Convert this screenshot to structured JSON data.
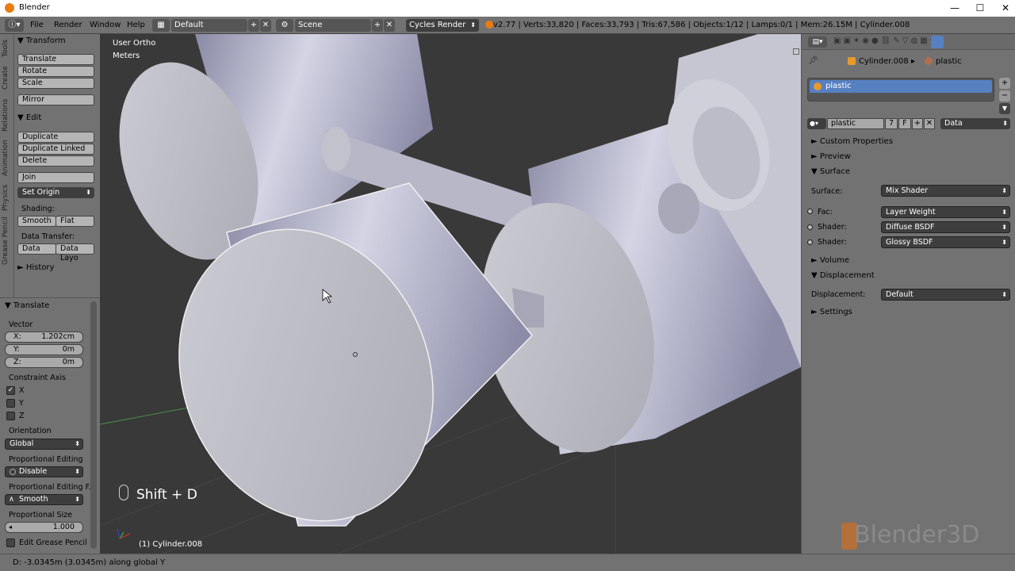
{
  "window": {
    "title": "Blender",
    "controls": [
      "—",
      "☐",
      "✕"
    ]
  },
  "header": {
    "menus": [
      "File",
      "Render",
      "Window",
      "Help"
    ],
    "layout": "Default",
    "scene": "Scene",
    "engine": "Cycles Render",
    "stats": "v2.77 | Verts:33,820 | Faces:33,793 | Tris:67,586 | Objects:1/12 | Lamps:0/1 | Mem:26.15M | Cylinder.008"
  },
  "tool_tabs": [
    "Tools",
    "Create",
    "Relations",
    "Animation",
    "Physics",
    "Grease Pencil"
  ],
  "toolshelf": {
    "transform_header": "Transform",
    "transform_buttons": [
      "Translate",
      "Rotate",
      "Scale"
    ],
    "mirror": "Mirror",
    "edit_header": "Edit",
    "edit_buttons": [
      "Duplicate",
      "Duplicate Linked",
      "Delete"
    ],
    "join": "Join",
    "set_origin": "Set Origin",
    "shading_label": "Shading:",
    "smooth": "Smooth",
    "flat": "Flat",
    "data_transfer_label": "Data Transfer:",
    "data": "Data",
    "data_layout": "Data Layo",
    "history_header": "History"
  },
  "operator": {
    "header": "Translate",
    "vector_label": "Vector",
    "x_label": "X:",
    "x_value": "1.202cm",
    "y_label": "Y:",
    "y_value": "0m",
    "z_label": "Z:",
    "z_value": "0m",
    "constraint_label": "Constraint Axis",
    "axes": [
      "X",
      "Y",
      "Z"
    ],
    "axes_checked": [
      true,
      false,
      false
    ],
    "orientation_label": "Orientation",
    "orientation_value": "Global",
    "prop_editing_label": "Proportional Editing",
    "prop_editing_value": "Disable",
    "prop_falloff_label": "Proportional Editing F...",
    "prop_falloff_value": "Smooth",
    "prop_size_label": "Proportional Size",
    "prop_size_value": "1.000",
    "grease_label": "Edit Grease Pencil"
  },
  "viewport": {
    "view_name": "User Ortho",
    "units": "Meters",
    "shortcut": "Shift + D",
    "object_label": "(1) Cylinder.008",
    "watermark": "Blender3D"
  },
  "properties": {
    "breadcrumb_object": "Cylinder.008",
    "breadcrumb_material": "plastic",
    "slot_name": "plastic",
    "material_name": "plastic",
    "users": "7",
    "fake": "F",
    "link": "Data",
    "sections": {
      "custom_props": "Custom Properties",
      "preview": "Preview",
      "surface": "Surface",
      "volume": "Volume",
      "displacement": "Displacement",
      "settings": "Settings"
    },
    "surface_label": "Surface:",
    "surface_value": "Mix Shader",
    "fac_label": "Fac:",
    "fac_value": "Layer Weight",
    "shader1_label": "Shader:",
    "shader1_value": "Diffuse BSDF",
    "shader2_label": "Shader:",
    "shader2_value": "Glossy BSDF",
    "displacement_label": "Displacement:",
    "displacement_value": "Default"
  },
  "status": {
    "text": "D: -3.0345m (3.0345m) along global Y"
  },
  "colors": {
    "accent": "#5680c2",
    "material_orange": "#e89a2a",
    "panel_bg": "#727272",
    "viewport_bg": "#393939"
  }
}
